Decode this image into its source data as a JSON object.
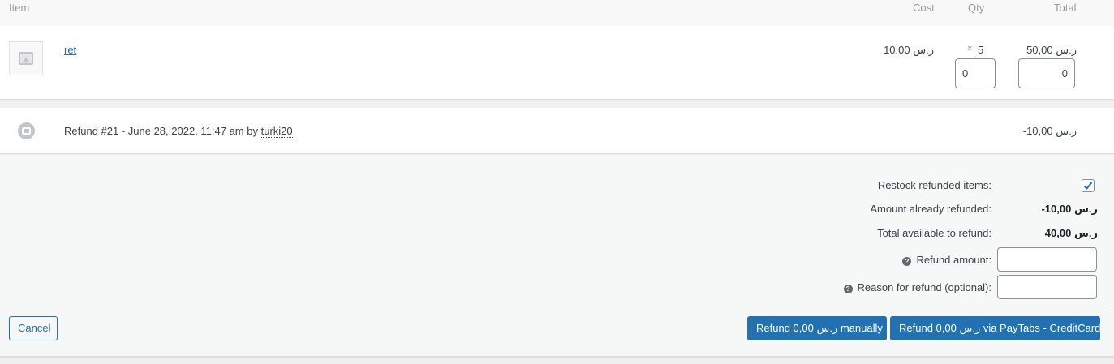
{
  "header": {
    "item": "Item",
    "cost": "Cost",
    "qty": "Qty",
    "total": "Total"
  },
  "item": {
    "name": "ret",
    "thumbnail_icon": "image-placeholder-icon",
    "cost": "10,00 ر.س",
    "qty_prefix": "×",
    "qty": "5",
    "total": "50,00 ر.س",
    "refund_qty_value": "0",
    "refund_total_value": "0"
  },
  "refund_entry": {
    "icon": "refund-icon",
    "text": "Refund #21 - June 28, 2022, 11:47 am by ",
    "user": "turki20",
    "amount": "-10,00 ر.س"
  },
  "refund_form": {
    "restock_label": "Restock refunded items:",
    "restock_checked": true,
    "already_refunded_label": "Amount already refunded:",
    "already_refunded_value": "-10,00 ر.س",
    "available_label": "Total available to refund:",
    "available_value": "40,00 ر.س",
    "amount_label": "Refund amount:",
    "amount_value": "",
    "reason_label": "Reason for refund (optional):",
    "reason_value": "",
    "help_glyph": "?"
  },
  "buttons": {
    "cancel": "Cancel",
    "refund_manual": "Refund 0,00 ر.س manually",
    "refund_gateway": "Refund 0,00 ر.س via PayTabs - CreditCard"
  },
  "colors": {
    "primary": "#2271b1",
    "link": "#2271b1",
    "panel_bg": "#f6f7f7"
  }
}
